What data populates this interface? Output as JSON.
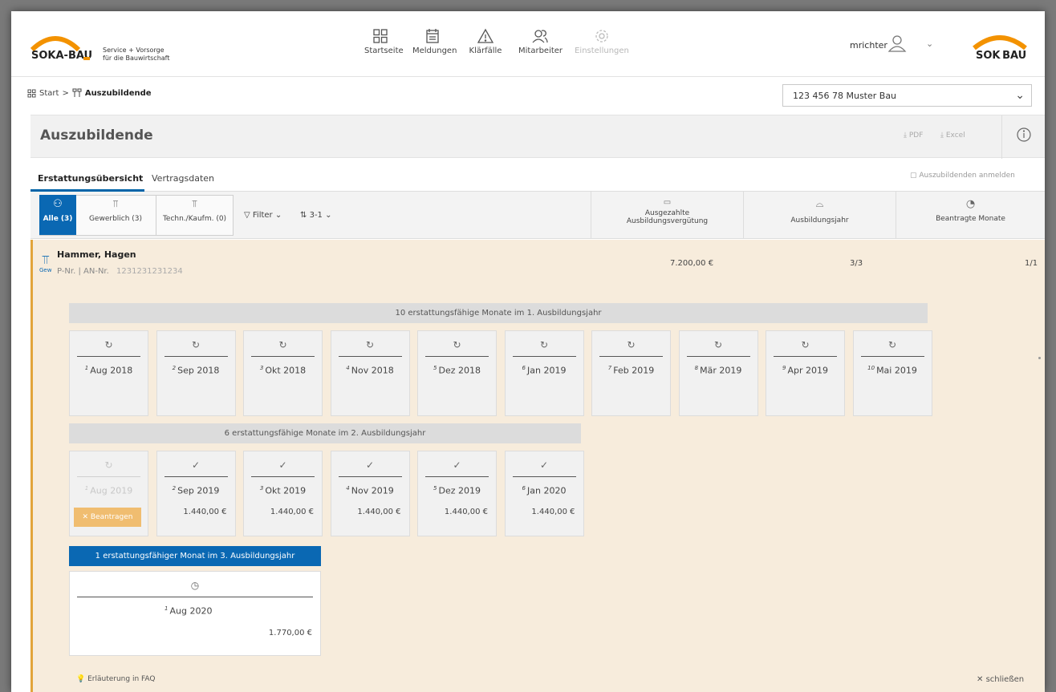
{
  "brand": {
    "logo_text": "SOKA-BAU",
    "tagline_1": "Service + Vorsorge",
    "tagline_2": "für die Bauwirtschaft",
    "logo2_text": "SOK BAU"
  },
  "nav": [
    {
      "label": "Startseite",
      "icon": "grid-icon"
    },
    {
      "label": "Meldungen",
      "icon": "calendar-icon"
    },
    {
      "label": "Klärfälle",
      "icon": "warning-icon"
    },
    {
      "label": "Mitarbeiter",
      "icon": "users-icon"
    },
    {
      "label": "Einstellungen",
      "icon": "gear-icon"
    }
  ],
  "user": {
    "name": "mrichter"
  },
  "breadcrumb": {
    "start": "Start",
    "separator": ">",
    "current": "Auszubildende"
  },
  "company_select": {
    "value": "123 456 78 Muster Bau"
  },
  "page": {
    "title": "Auszubildende",
    "pdf": "PDF",
    "excel": "Excel"
  },
  "tabs": [
    {
      "label": "Erstattungsübersicht",
      "active": true
    },
    {
      "label": "Vertragsdaten",
      "active": false
    }
  ],
  "enroll_link": "Auszubildenden anmelden",
  "filters": {
    "all": "Alle (3)",
    "commercial": "Gewerblich (3)",
    "tech": "Techn./Kaufm. (0)",
    "filter": "Filter",
    "sort": "3-1"
  },
  "columns": {
    "paid_1": "Ausgezahlte",
    "paid_2": "Ausbildungsvergütung",
    "year": "Ausbildungsjahr",
    "months": "Beantragte Monate"
  },
  "person": {
    "name": "Hammer, Hagen",
    "pnr_label": "P-Nr.",
    "an_label": "AN-Nr.",
    "an_value": "1231231231234",
    "type": "Gew",
    "paid": "7.200,00 €",
    "year": "3/3",
    "months": "1/1"
  },
  "years": [
    {
      "title": "10 erstattungsfähige Monate im 1. Ausbildungsjahr",
      "months": [
        {
          "n": "1",
          "label": "Aug 2018",
          "status": "pending"
        },
        {
          "n": "2",
          "label": "Sep 2018",
          "status": "pending"
        },
        {
          "n": "3",
          "label": "Okt 2018",
          "status": "pending"
        },
        {
          "n": "4",
          "label": "Nov 2018",
          "status": "pending"
        },
        {
          "n": "5",
          "label": "Dez 2018",
          "status": "pending"
        },
        {
          "n": "6",
          "label": "Jan 2019",
          "status": "pending"
        },
        {
          "n": "7",
          "label": "Feb 2019",
          "status": "pending"
        },
        {
          "n": "8",
          "label": "Mär 2019",
          "status": "pending"
        },
        {
          "n": "9",
          "label": "Apr 2019",
          "status": "pending"
        },
        {
          "n": "10",
          "label": "Mai 2019",
          "status": "pending"
        }
      ]
    },
    {
      "title": "6 erstattungsfähige Monate im 2. Ausbildungsjahr",
      "months": [
        {
          "n": "1",
          "label": "Aug 2019",
          "status": "open",
          "action": "Beantragen"
        },
        {
          "n": "2",
          "label": "Sep 2019",
          "status": "done",
          "amount": "1.440,00 €"
        },
        {
          "n": "3",
          "label": "Okt 2019",
          "status": "done",
          "amount": "1.440,00 €"
        },
        {
          "n": "4",
          "label": "Nov 2019",
          "status": "done",
          "amount": "1.440,00 €"
        },
        {
          "n": "5",
          "label": "Dez 2019",
          "status": "done",
          "amount": "1.440,00 €"
        },
        {
          "n": "6",
          "label": "Jan 2020",
          "status": "done",
          "amount": "1.440,00 €"
        }
      ]
    },
    {
      "title": "1 erstattungsfähiger Monat im 3. Ausbildungsjahr",
      "months": [
        {
          "n": "1",
          "label": "Aug 2020",
          "status": "scheduled",
          "amount": "1.770,00 €"
        }
      ]
    }
  ],
  "footer": {
    "faq": "Erläuterung in FAQ",
    "close": "schließen"
  }
}
